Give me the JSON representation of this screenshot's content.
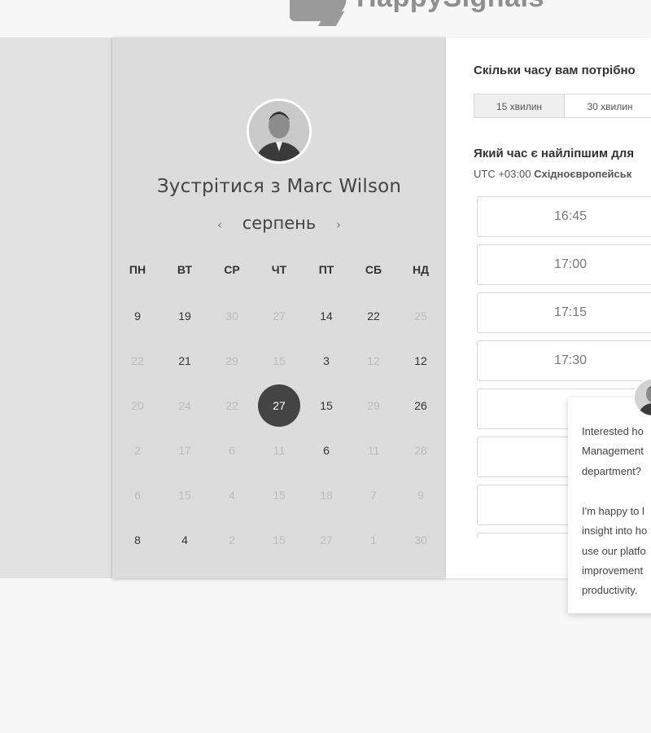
{
  "brand": {
    "name": "HappySignals"
  },
  "meeting": {
    "title": "Зустрітися з Marc Wilson",
    "avatar": "user-avatar-icon"
  },
  "calendar": {
    "month": "серпень",
    "prev_icon": "‹",
    "next_icon": "›",
    "weekdays": [
      "ПН",
      "ВТ",
      "СР",
      "ЧТ",
      "ПТ",
      "СБ",
      "НД"
    ],
    "weeks": [
      [
        {
          "d": "9",
          "a": 1
        },
        {
          "d": "19",
          "a": 1
        },
        {
          "d": "30",
          "a": 0
        },
        {
          "d": "27",
          "a": 0
        },
        {
          "d": "14",
          "a": 1
        },
        {
          "d": "22",
          "a": 1
        },
        {
          "d": "25",
          "a": 0
        }
      ],
      [
        {
          "d": "22",
          "a": 0
        },
        {
          "d": "21",
          "a": 1
        },
        {
          "d": "29",
          "a": 0
        },
        {
          "d": "15",
          "a": 0
        },
        {
          "d": "3",
          "a": 1
        },
        {
          "d": "12",
          "a": 0
        },
        {
          "d": "12",
          "a": 1
        }
      ],
      [
        {
          "d": "20",
          "a": 0
        },
        {
          "d": "24",
          "a": 0
        },
        {
          "d": "22",
          "a": 0
        },
        {
          "d": "27",
          "a": 1,
          "s": 1
        },
        {
          "d": "15",
          "a": 1
        },
        {
          "d": "29",
          "a": 0
        },
        {
          "d": "26",
          "a": 1
        }
      ],
      [
        {
          "d": "2",
          "a": 0
        },
        {
          "d": "17",
          "a": 0
        },
        {
          "d": "6",
          "a": 0
        },
        {
          "d": "11",
          "a": 0
        },
        {
          "d": "6",
          "a": 1
        },
        {
          "d": "11",
          "a": 0
        },
        {
          "d": "28",
          "a": 0
        }
      ],
      [
        {
          "d": "6",
          "a": 0
        },
        {
          "d": "15",
          "a": 0
        },
        {
          "d": "4",
          "a": 0
        },
        {
          "d": "15",
          "a": 0
        },
        {
          "d": "18",
          "a": 0
        },
        {
          "d": "7",
          "a": 0
        },
        {
          "d": "9",
          "a": 0
        }
      ],
      [
        {
          "d": "8",
          "a": 1
        },
        {
          "d": "4",
          "a": 1
        },
        {
          "d": "2",
          "a": 0
        },
        {
          "d": "15",
          "a": 0
        },
        {
          "d": "27",
          "a": 0
        },
        {
          "d": "1",
          "a": 0
        },
        {
          "d": "30",
          "a": 0
        }
      ]
    ]
  },
  "booking": {
    "duration_question": "Скільки часу вам потрібно",
    "durations": [
      {
        "label": "15 хвилин",
        "selected": true
      },
      {
        "label": "30 хвилин",
        "selected": false
      }
    ],
    "time_question": "Який час є найліпшим для",
    "timezone_prefix": "UTC +03:00",
    "timezone_name": "Східноєвропейськ",
    "slots": [
      "16:45",
      "17:00",
      "17:15",
      "17:30",
      "",
      "",
      "",
      ""
    ]
  },
  "chat": {
    "lines": [
      "Interested ho",
      "Management",
      "department?",
      "",
      "I'm happy to l",
      "insight into ho",
      "use our platfo",
      "improvement",
      "productivity."
    ]
  }
}
